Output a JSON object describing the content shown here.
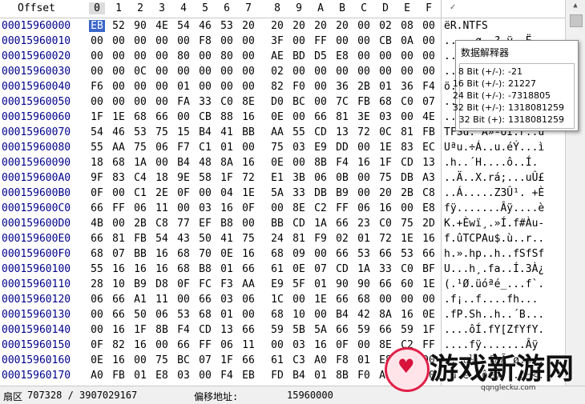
{
  "header": {
    "offset_label": "Offset",
    "hex_columns": [
      "0",
      "1",
      "2",
      "3",
      "4",
      "5",
      "6",
      "7",
      "8",
      "9",
      "A",
      "B",
      "C",
      "D",
      "E",
      "F"
    ],
    "text_column_button": "✓"
  },
  "rows": [
    {
      "offset": "00015960000",
      "bytes": [
        "EB",
        "52",
        "90",
        "4E",
        "54",
        "46",
        "53",
        "20",
        "20",
        "20",
        "20",
        "20",
        "00",
        "02",
        "08",
        "00"
      ],
      "text": "ëR.NTFS"
    },
    {
      "offset": "00015960010",
      "bytes": [
        "00",
        "00",
        "00",
        "00",
        "00",
        "F8",
        "00",
        "00",
        "3F",
        "00",
        "FF",
        "00",
        "00",
        "CB",
        "0A",
        "00"
      ],
      "text": ".....ø..?.ÿ..Ë.."
    },
    {
      "offset": "00015960020",
      "bytes": [
        "00",
        "00",
        "00",
        "00",
        "80",
        "00",
        "80",
        "00",
        "AE",
        "BD",
        "D5",
        "E8",
        "00",
        "00",
        "00",
        "00"
      ],
      "text": "........®½Õè...."
    },
    {
      "offset": "00015960030",
      "bytes": [
        "00",
        "00",
        "0C",
        "00",
        "00",
        "00",
        "00",
        "00",
        "02",
        "00",
        "00",
        "00",
        "00",
        "00",
        "00",
        "00"
      ],
      "text": "................"
    },
    {
      "offset": "00015960040",
      "bytes": [
        "F6",
        "00",
        "00",
        "00",
        "01",
        "00",
        "00",
        "00",
        "82",
        "F0",
        "00",
        "36",
        "2B",
        "01",
        "36",
        "F4"
      ],
      "text": "ö........ð.6+.6ô"
    },
    {
      "offset": "00015960050",
      "bytes": [
        "00",
        "00",
        "00",
        "00",
        "FA",
        "33",
        "C0",
        "8E",
        "D0",
        "BC",
        "00",
        "7C",
        "FB",
        "68",
        "C0",
        "07"
      ],
      "text": "....ú3À.Ð¼.|ûhÀ."
    },
    {
      "offset": "00015960060",
      "bytes": [
        "1F",
        "1E",
        "68",
        "66",
        "00",
        "CB",
        "88",
        "16",
        "0E",
        "00",
        "66",
        "81",
        "3E",
        "03",
        "00",
        "4E"
      ],
      "text": "..hf.Ë....f.>..N"
    },
    {
      "offset": "00015960070",
      "bytes": [
        "54",
        "46",
        "53",
        "75",
        "15",
        "B4",
        "41",
        "BB",
        "AA",
        "55",
        "CD",
        "13",
        "72",
        "0C",
        "81",
        "FB"
      ],
      "text": "TFSu.´A»ªUÍ.r..û"
    },
    {
      "offset": "00015960080",
      "bytes": [
        "55",
        "AA",
        "75",
        "06",
        "F7",
        "C1",
        "01",
        "00",
        "75",
        "03",
        "E9",
        "DD",
        "00",
        "1E",
        "83",
        "EC"
      ],
      "text": "Uªu.÷Á..u.éÝ...ì"
    },
    {
      "offset": "00015960090",
      "bytes": [
        "18",
        "68",
        "1A",
        "00",
        "B4",
        "48",
        "8A",
        "16",
        "0E",
        "00",
        "8B",
        "F4",
        "16",
        "1F",
        "CD",
        "13"
      ],
      "text": ".h..´H....ô..Í."
    },
    {
      "offset": "000159600A0",
      "bytes": [
        "9F",
        "83",
        "C4",
        "18",
        "9E",
        "58",
        "1F",
        "72",
        "E1",
        "3B",
        "06",
        "0B",
        "00",
        "75",
        "DB",
        "A3"
      ],
      "text": "..Ä..X.rá;...uÛ£"
    },
    {
      "offset": "000159600B0",
      "bytes": [
        "0F",
        "00",
        "C1",
        "2E",
        "0F",
        "00",
        "04",
        "1E",
        "5A",
        "33",
        "DB",
        "B9",
        "00",
        "20",
        "2B",
        "C8"
      ],
      "text": "..Á.....Z3Û¹. +È"
    },
    {
      "offset": "000159600C0",
      "bytes": [
        "66",
        "FF",
        "06",
        "11",
        "00",
        "03",
        "16",
        "0F",
        "00",
        "8E",
        "C2",
        "FF",
        "06",
        "16",
        "00",
        "E8"
      ],
      "text": "fÿ.......Âÿ....è"
    },
    {
      "offset": "000159600D0",
      "bytes": [
        "4B",
        "00",
        "2B",
        "C8",
        "77",
        "EF",
        "B8",
        "00",
        "BB",
        "CD",
        "1A",
        "66",
        "23",
        "C0",
        "75",
        "2D"
      ],
      "text": "K.+Èwï¸.»Í.f#Àu-"
    },
    {
      "offset": "000159600E0",
      "bytes": [
        "66",
        "81",
        "FB",
        "54",
        "43",
        "50",
        "41",
        "75",
        "24",
        "81",
        "F9",
        "02",
        "01",
        "72",
        "1E",
        "16"
      ],
      "text": "f.ûTCPAu$.ù..r.."
    },
    {
      "offset": "000159600F0",
      "bytes": [
        "68",
        "07",
        "BB",
        "16",
        "68",
        "70",
        "0E",
        "16",
        "68",
        "09",
        "00",
        "66",
        "53",
        "66",
        "53",
        "66"
      ],
      "text": "h.».hp..h..fSfSf"
    },
    {
      "offset": "00015960100",
      "bytes": [
        "55",
        "16",
        "16",
        "16",
        "68",
        "B8",
        "01",
        "66",
        "61",
        "0E",
        "07",
        "CD",
        "1A",
        "33",
        "C0",
        "BF"
      ],
      "text": "U...h¸.fa..Í.3À¿"
    },
    {
      "offset": "00015960110",
      "bytes": [
        "28",
        "10",
        "B9",
        "D8",
        "0F",
        "FC",
        "F3",
        "AA",
        "E9",
        "5F",
        "01",
        "90",
        "90",
        "66",
        "60",
        "1E"
      ],
      "text": "(.¹Ø.üóªé_...f`."
    },
    {
      "offset": "00015960120",
      "bytes": [
        "06",
        "66",
        "A1",
        "11",
        "00",
        "66",
        "03",
        "06",
        "1C",
        "00",
        "1E",
        "66",
        "68",
        "00",
        "00",
        "00"
      ],
      "text": ".f¡..f....fh..."
    },
    {
      "offset": "00015960130",
      "bytes": [
        "00",
        "66",
        "50",
        "06",
        "53",
        "68",
        "01",
        "00",
        "68",
        "10",
        "00",
        "B4",
        "42",
        "8A",
        "16",
        "0E"
      ],
      "text": ".fP.Sh..h..´B..."
    },
    {
      "offset": "00015960140",
      "bytes": [
        "00",
        "16",
        "1F",
        "8B",
        "F4",
        "CD",
        "13",
        "66",
        "59",
        "5B",
        "5A",
        "66",
        "59",
        "66",
        "59",
        "1F"
      ],
      "text": "....ôÍ.fY[ZfYfY."
    },
    {
      "offset": "00015960150",
      "bytes": [
        "0F",
        "82",
        "16",
        "00",
        "66",
        "FF",
        "06",
        "11",
        "00",
        "03",
        "16",
        "0F",
        "00",
        "8E",
        "C2",
        "FF"
      ],
      "text": "....fÿ.......Âÿ"
    },
    {
      "offset": "00015960160",
      "bytes": [
        "0E",
        "16",
        "00",
        "75",
        "BC",
        "07",
        "1F",
        "66",
        "61",
        "C3",
        "A0",
        "F8",
        "01",
        "E8",
        "09",
        "00"
      ],
      "text": "...u¼..faÃ ø.è.."
    },
    {
      "offset": "00015960170",
      "bytes": [
        "A0",
        "FB",
        "01",
        "E8",
        "03",
        "00",
        "F4",
        "EB",
        "FD",
        "B4",
        "01",
        "8B",
        "F0",
        "AC",
        "3C",
        "00"
      ],
      "text": " û.è..ôëý´..ð¬<."
    }
  ],
  "inspector": {
    "title": "数据解释器",
    "rows": [
      {
        "label": "8 Bit (+/-):",
        "value": "-21"
      },
      {
        "label": "16 Bit (+/-):",
        "value": "21227"
      },
      {
        "label": "24 Bit (+/-):",
        "value": "-7318805"
      },
      {
        "label": "32 Bit (+/-):",
        "value": "1318081259"
      },
      {
        "label": "32 Bit (+):",
        "value": "1318081259"
      }
    ]
  },
  "status": {
    "sector_label": "扇区",
    "sector_value": "707328 / 3907029167",
    "offset_label": "偏移地址:",
    "offset_value": "15960000"
  },
  "watermark": {
    "brand": "游戏新游网",
    "domain": "qqnglecku.com"
  }
}
